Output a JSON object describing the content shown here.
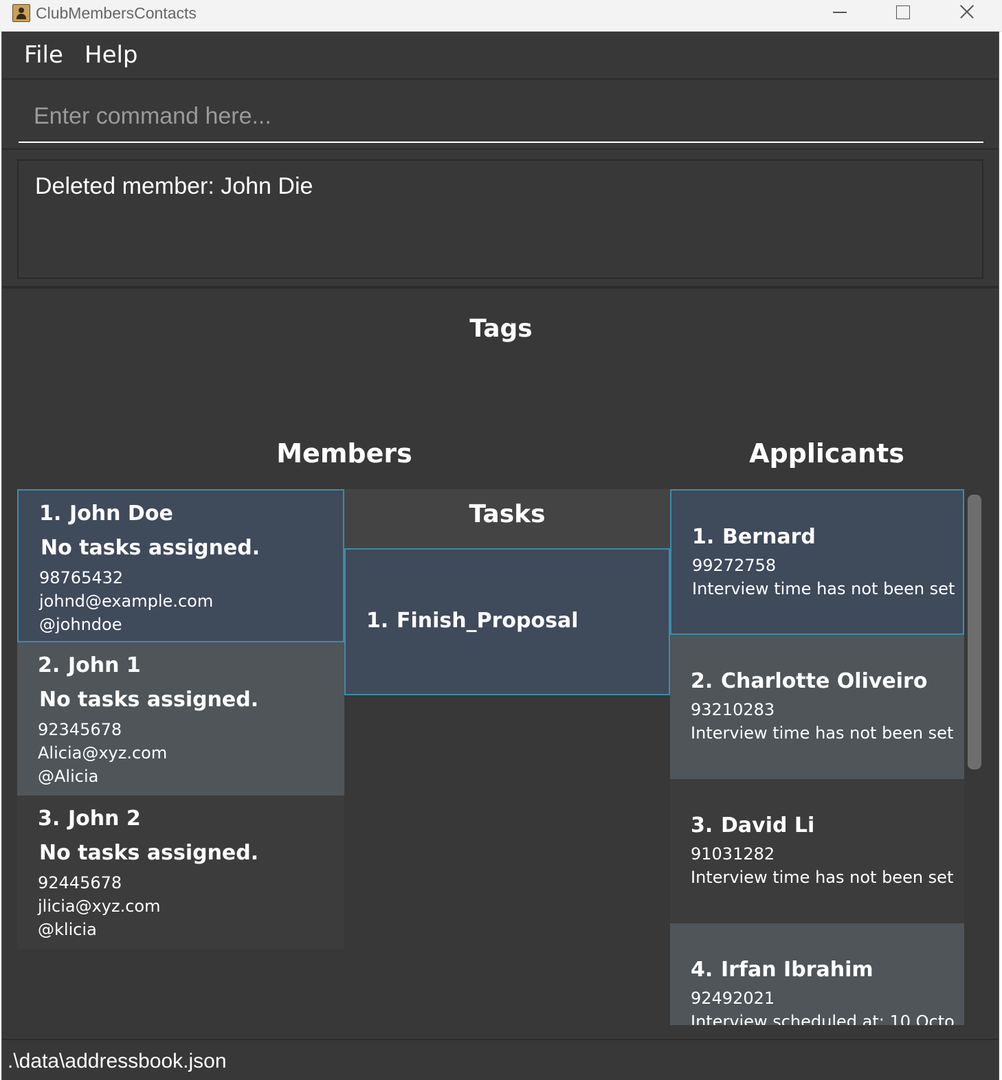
{
  "window": {
    "title": "ClubMembersContacts"
  },
  "menu": {
    "file": "File",
    "help": "Help"
  },
  "command": {
    "placeholder": "Enter command here...",
    "value": ""
  },
  "result": {
    "text": "Deleted member: John Die"
  },
  "tags": {
    "heading": "Tags"
  },
  "members": {
    "heading": "Members",
    "items": [
      {
        "index": "1.",
        "name": "John Doe",
        "tasks": "No tasks assigned.",
        "phone": "98765432",
        "email": "johnd@example.com",
        "telegram": "@johndoe"
      },
      {
        "index": "2.",
        "name": "John 1",
        "tasks": "No tasks assigned.",
        "phone": "92345678",
        "email": "Alicia@xyz.com",
        "telegram": "@Alicia"
      },
      {
        "index": "3.",
        "name": "John 2",
        "tasks": "No tasks assigned.",
        "phone": "92445678",
        "email": "jlicia@xyz.com",
        "telegram": "@klicia"
      }
    ]
  },
  "tasks": {
    "heading": "Tasks",
    "items": [
      {
        "index": "1.",
        "name": "Finish_Proposal"
      }
    ]
  },
  "applicants": {
    "heading": "Applicants",
    "items": [
      {
        "index": "1.",
        "name": "Bernard",
        "phone": "99272758",
        "interview": "Interview time has not been set"
      },
      {
        "index": "2.",
        "name": "Charlotte Oliveiro",
        "phone": "93210283",
        "interview": "Interview time has not been set"
      },
      {
        "index": "3.",
        "name": "David Li",
        "phone": "91031282",
        "interview": "Interview time has not been set"
      },
      {
        "index": "4.",
        "name": "Irfan Ibrahim",
        "phone": "92492021",
        "interview": "Interview scheduled at: 10 Octo"
      }
    ]
  },
  "status": {
    "path": ".\\data\\addressbook.json"
  },
  "colors": {
    "background": "#383838",
    "selected_card": "#3f4a5b",
    "alt_card": "#4f5559",
    "accent_border": "#3b8ca8"
  }
}
